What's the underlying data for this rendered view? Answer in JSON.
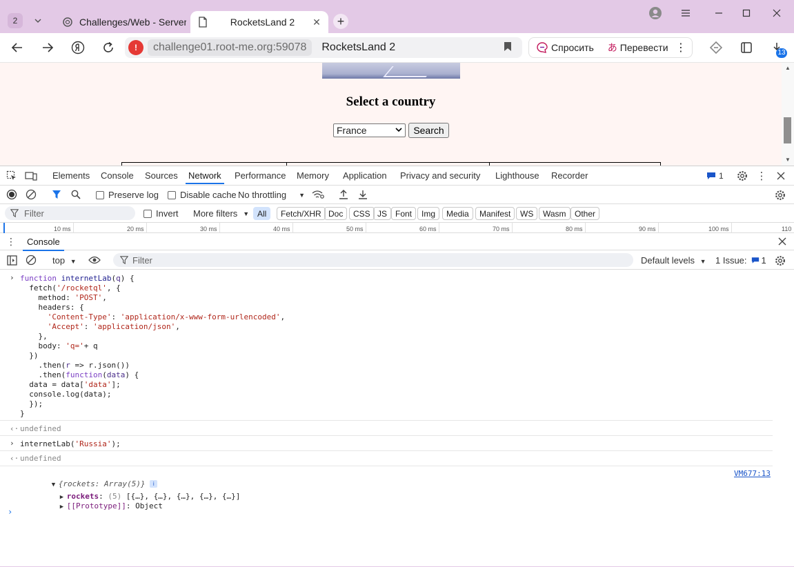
{
  "browser": {
    "tab_count": "2",
    "tabs": [
      {
        "title": "Challenges/Web - Server :",
        "active": false
      },
      {
        "title": "RocketsLand 2",
        "active": true
      }
    ],
    "url": "challenge01.root-me.org:59078",
    "page_title": "RocketsLand 2",
    "ask_label": "Спросить",
    "translate_label": "Перевести",
    "downloads_badge": "13"
  },
  "page": {
    "heading": "Select a country",
    "country_selected": "France",
    "search_label": "Search"
  },
  "devtools": {
    "tabs": [
      "Elements",
      "Console",
      "Sources",
      "Network",
      "Performance",
      "Memory",
      "Application",
      "Privacy and security",
      "Lighthouse",
      "Recorder"
    ],
    "active_tab": "Network",
    "issues_badge": "1",
    "network": {
      "preserve_log": "Preserve log",
      "disable_cache": "Disable cache",
      "throttling": "No throttling",
      "filter_placeholder": "Filter",
      "invert": "Invert",
      "more_filters": "More filters",
      "type_chips": [
        "All",
        "Fetch/XHR",
        "Doc",
        "CSS",
        "JS",
        "Font",
        "Img",
        "Media",
        "Manifest",
        "WS",
        "Wasm",
        "Other"
      ],
      "timeline_ticks": [
        "10 ms",
        "20 ms",
        "30 ms",
        "40 ms",
        "50 ms",
        "60 ms",
        "70 ms",
        "80 ms",
        "90 ms",
        "100 ms",
        "110"
      ]
    },
    "console": {
      "drawer_tab": "Console",
      "context": "top",
      "filter_placeholder": "Filter",
      "levels": "Default levels",
      "issues_label": "1 Issue:",
      "issues_count": "1",
      "undefined": "undefined",
      "call_line": "internetLab('Russia');",
      "result_summary": "{rockets: Array(5)}",
      "result_prop": "rockets",
      "result_prop_count": "(5)",
      "result_prop_value": "[{…}, {…}, {…}, {…}, {…}]",
      "prototype_label": "[[Prototype]]",
      "prototype_value": "Object",
      "source_link": "VM677:13"
    }
  }
}
